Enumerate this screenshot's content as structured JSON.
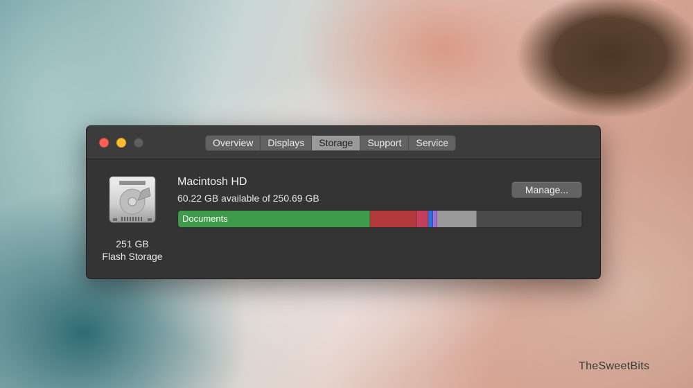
{
  "window": {
    "tabs": [
      {
        "label": "Overview",
        "active": false
      },
      {
        "label": "Displays",
        "active": false
      },
      {
        "label": "Storage",
        "active": true
      },
      {
        "label": "Support",
        "active": false
      },
      {
        "label": "Service",
        "active": false
      }
    ]
  },
  "storage": {
    "disk_size": "251 GB",
    "disk_type": "Flash Storage",
    "volume_name": "Macintosh HD",
    "available_text": "60.22 GB available of 250.69 GB",
    "manage_label": "Manage...",
    "segments": [
      {
        "name": "Documents",
        "label": "Documents",
        "color": "#3e9b4a",
        "fraction": 0.475
      },
      {
        "name": "other-red",
        "label": "",
        "color": "#b23a3c",
        "fraction": 0.115
      },
      {
        "name": "other-pink",
        "label": "",
        "color": "#c2405d",
        "fraction": 0.03
      },
      {
        "name": "other-blue",
        "label": "",
        "color": "#2f6fd6",
        "fraction": 0.012
      },
      {
        "name": "other-purple",
        "label": "",
        "color": "#a56ad4",
        "fraction": 0.01
      },
      {
        "name": "system-gray",
        "label": "",
        "color": "#9a9a9b",
        "fraction": 0.098
      },
      {
        "name": "free-space",
        "label": "",
        "color": "#4a4a4b",
        "fraction": 0.26
      }
    ]
  },
  "watermark": "TheSweetBits",
  "colors": {
    "close": "#fe5f57",
    "minimize": "#febc2e",
    "zoom_disabled": "#5f5f60",
    "window_bg": "#3a3a3b"
  }
}
